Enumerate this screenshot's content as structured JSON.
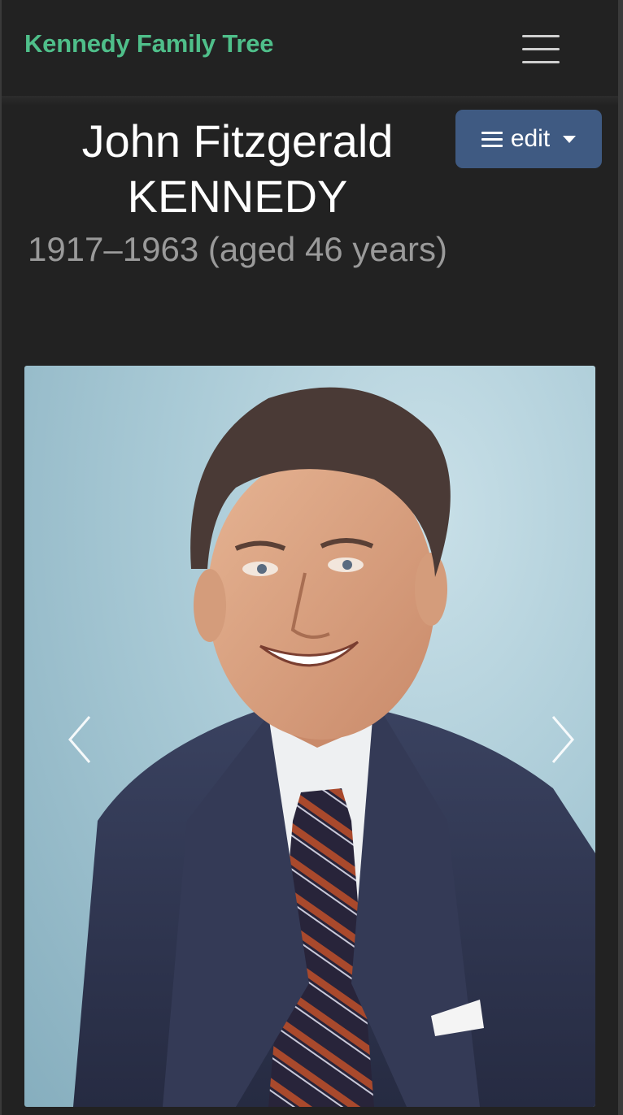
{
  "navbar": {
    "brand": "Kennedy Family Tree",
    "menu_icon": "hamburger-menu-icon"
  },
  "person": {
    "given_names": "John Fitzgerald",
    "surname": "KENNEDY",
    "dates": "1917–1963 (aged 46 years)"
  },
  "edit_button": {
    "label": "edit",
    "icon": "list-icon",
    "dropdown_icon": "caret-down-icon"
  },
  "carousel": {
    "image_alt": "John Fitzgerald Kennedy portrait",
    "prev_icon": "chevron-left-icon",
    "next_icon": "chevron-right-icon"
  },
  "colors": {
    "background": "#222222",
    "brand": "#4fbf8a",
    "button": "#3f5a82",
    "muted_text": "#9a9a9a"
  }
}
